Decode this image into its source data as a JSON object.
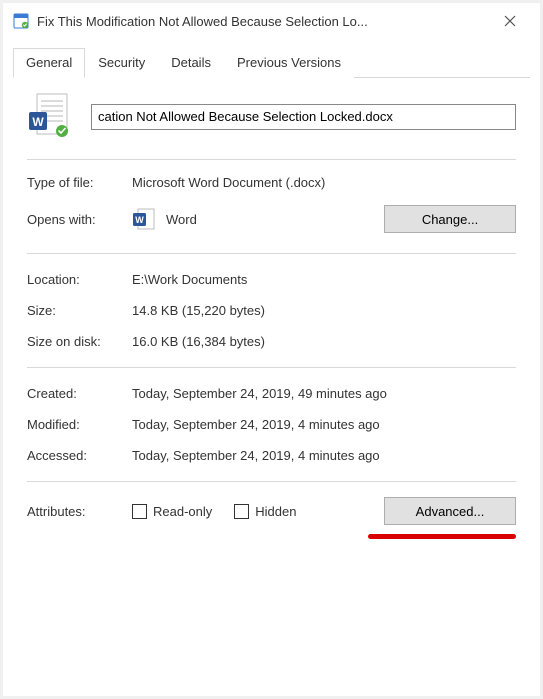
{
  "window": {
    "title": "Fix This Modification Not Allowed Because Selection Lo..."
  },
  "tabs": {
    "general": "General",
    "security": "Security",
    "details": "Details",
    "previous_versions": "Previous Versions"
  },
  "filename": "cation Not Allowed Because Selection Locked.docx",
  "labels": {
    "type_of_file": "Type of file:",
    "opens_with": "Opens with:",
    "location": "Location:",
    "size": "Size:",
    "size_on_disk": "Size on disk:",
    "created": "Created:",
    "modified": "Modified:",
    "accessed": "Accessed:",
    "attributes": "Attributes:"
  },
  "values": {
    "type_of_file": "Microsoft Word Document (.docx)",
    "opens_with_app": "Word",
    "location": "E:\\Work Documents",
    "size": "14.8 KB (15,220 bytes)",
    "size_on_disk": "16.0 KB (16,384 bytes)",
    "created": "Today, September 24, 2019, 49 minutes ago",
    "modified": "Today, September 24, 2019, 4 minutes ago",
    "accessed": "Today, September 24, 2019, 4 minutes ago"
  },
  "buttons": {
    "change": "Change...",
    "advanced": "Advanced..."
  },
  "checkboxes": {
    "read_only": "Read-only",
    "hidden": "Hidden"
  }
}
